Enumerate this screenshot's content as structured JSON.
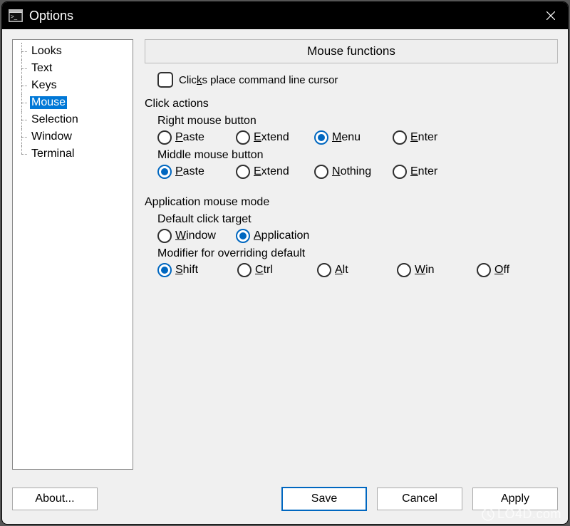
{
  "window": {
    "title": "Options"
  },
  "sidebar": {
    "items": [
      {
        "label": "Looks"
      },
      {
        "label": "Text"
      },
      {
        "label": "Keys"
      },
      {
        "label": "Mouse",
        "selected": true
      },
      {
        "label": "Selection"
      },
      {
        "label": "Window"
      },
      {
        "label": "Terminal"
      }
    ]
  },
  "main": {
    "header": "Mouse functions",
    "checkbox_clicks_place": {
      "label_pre": "Clic",
      "label_u": "k",
      "label_post": "s place command line cursor",
      "checked": false
    },
    "click_actions": {
      "title": "Click actions",
      "right": {
        "title": "Right mouse button",
        "options": [
          {
            "u": "P",
            "rest": "aste",
            "selected": false
          },
          {
            "u": "E",
            "rest": "xtend",
            "selected": false
          },
          {
            "u": "M",
            "rest": "enu",
            "selected": true
          },
          {
            "u": "E",
            "rest": "nter",
            "selected": false
          }
        ]
      },
      "middle": {
        "title": "Middle mouse button",
        "options": [
          {
            "u": "P",
            "rest": "aste",
            "selected": true
          },
          {
            "u": "E",
            "rest": "xtend",
            "selected": false
          },
          {
            "u": "N",
            "rest": "othing",
            "selected": false
          },
          {
            "u": "E",
            "rest": "nter",
            "selected": false
          }
        ]
      }
    },
    "app_mode": {
      "title": "Application mouse mode",
      "target": {
        "title": "Default click target",
        "options": [
          {
            "u": "W",
            "rest": "indow",
            "selected": false
          },
          {
            "u": "A",
            "rest": "pplication",
            "selected": true
          }
        ]
      },
      "modifier": {
        "title": "Modifier for overriding default",
        "options": [
          {
            "u": "S",
            "rest": "hift",
            "selected": true
          },
          {
            "u": "C",
            "rest": "trl",
            "selected": false
          },
          {
            "u": "A",
            "rest": "lt",
            "selected": false
          },
          {
            "u": "W",
            "rest": "in",
            "selected": false
          },
          {
            "u": "O",
            "rest": "ff",
            "selected": false
          }
        ]
      }
    }
  },
  "buttons": {
    "about": "About...",
    "save": "Save",
    "cancel": "Cancel",
    "apply": "Apply"
  },
  "watermark": "LO4D.com"
}
